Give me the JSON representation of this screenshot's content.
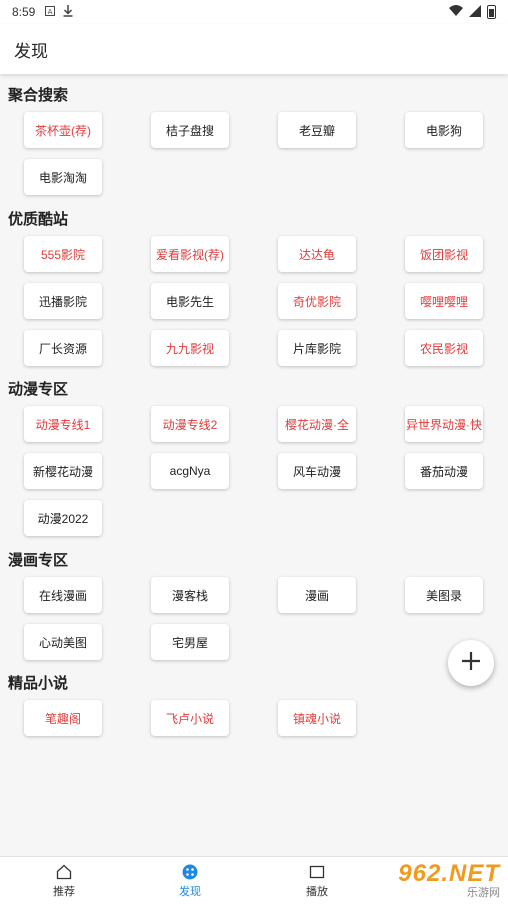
{
  "status_bar": {
    "time": "8:59",
    "icons": [
      "a-box-icon",
      "download-icon",
      "wifi-icon",
      "signal-icon",
      "battery-icon"
    ]
  },
  "header": {
    "title": "发现"
  },
  "sections": [
    {
      "title": "聚合搜索",
      "items": [
        {
          "label": "茶杯壶(荐)",
          "red": true
        },
        {
          "label": "桔子盘搜",
          "red": false
        },
        {
          "label": "老豆瓣",
          "red": false
        },
        {
          "label": "电影狗",
          "red": false
        },
        {
          "label": "电影淘淘",
          "red": false
        }
      ]
    },
    {
      "title": "优质酷站",
      "items": [
        {
          "label": "555影院",
          "red": true
        },
        {
          "label": "爱看影视(荐)",
          "red": true
        },
        {
          "label": "达达龟",
          "red": true
        },
        {
          "label": "饭团影视",
          "red": true
        },
        {
          "label": "迅播影院",
          "red": false
        },
        {
          "label": "电影先生",
          "red": false
        },
        {
          "label": "奇优影院",
          "red": true
        },
        {
          "label": "嘤哩嘤哩",
          "red": true
        },
        {
          "label": "厂长资源",
          "red": false
        },
        {
          "label": "九九影视",
          "red": true
        },
        {
          "label": "片库影院",
          "red": false
        },
        {
          "label": "农民影视",
          "red": true
        }
      ]
    },
    {
      "title": "动漫专区",
      "items": [
        {
          "label": "动漫专线1",
          "red": true
        },
        {
          "label": "动漫专线2",
          "red": true
        },
        {
          "label": "樱花动漫·全",
          "red": true
        },
        {
          "label": "异世界动漫·快",
          "red": true
        },
        {
          "label": "新樱花动漫",
          "red": false
        },
        {
          "label": "acgNya",
          "red": false
        },
        {
          "label": "风车动漫",
          "red": false
        },
        {
          "label": "番茄动漫",
          "red": false
        },
        {
          "label": "动漫2022",
          "red": false
        }
      ]
    },
    {
      "title": "漫画专区",
      "items": [
        {
          "label": "在线漫画",
          "red": false
        },
        {
          "label": "漫客栈",
          "red": false
        },
        {
          "label": "漫画",
          "red": false
        },
        {
          "label": "美图录",
          "red": false
        },
        {
          "label": "心动美图",
          "red": false
        },
        {
          "label": "宅男屋",
          "red": false
        }
      ]
    },
    {
      "title": "精品小说",
      "items": [
        {
          "label": "笔趣阁",
          "red": true
        },
        {
          "label": "飞卢小说",
          "red": true
        },
        {
          "label": "镇魂小说",
          "red": true
        }
      ]
    }
  ],
  "fab": {
    "icon": "plus-icon"
  },
  "bottom_nav": {
    "items": [
      {
        "label": "推荐",
        "icon": "home-icon",
        "active": false
      },
      {
        "label": "发现",
        "icon": "discover-grid-icon",
        "active": true
      },
      {
        "label": "播放",
        "icon": "play-screen-icon",
        "active": false
      }
    ]
  },
  "watermark": {
    "top": "962.NET",
    "bottom": "乐游网"
  },
  "colors": {
    "accent": "#1e88e5",
    "red_text": "#e03c3c",
    "background": "#f6f6f6"
  }
}
